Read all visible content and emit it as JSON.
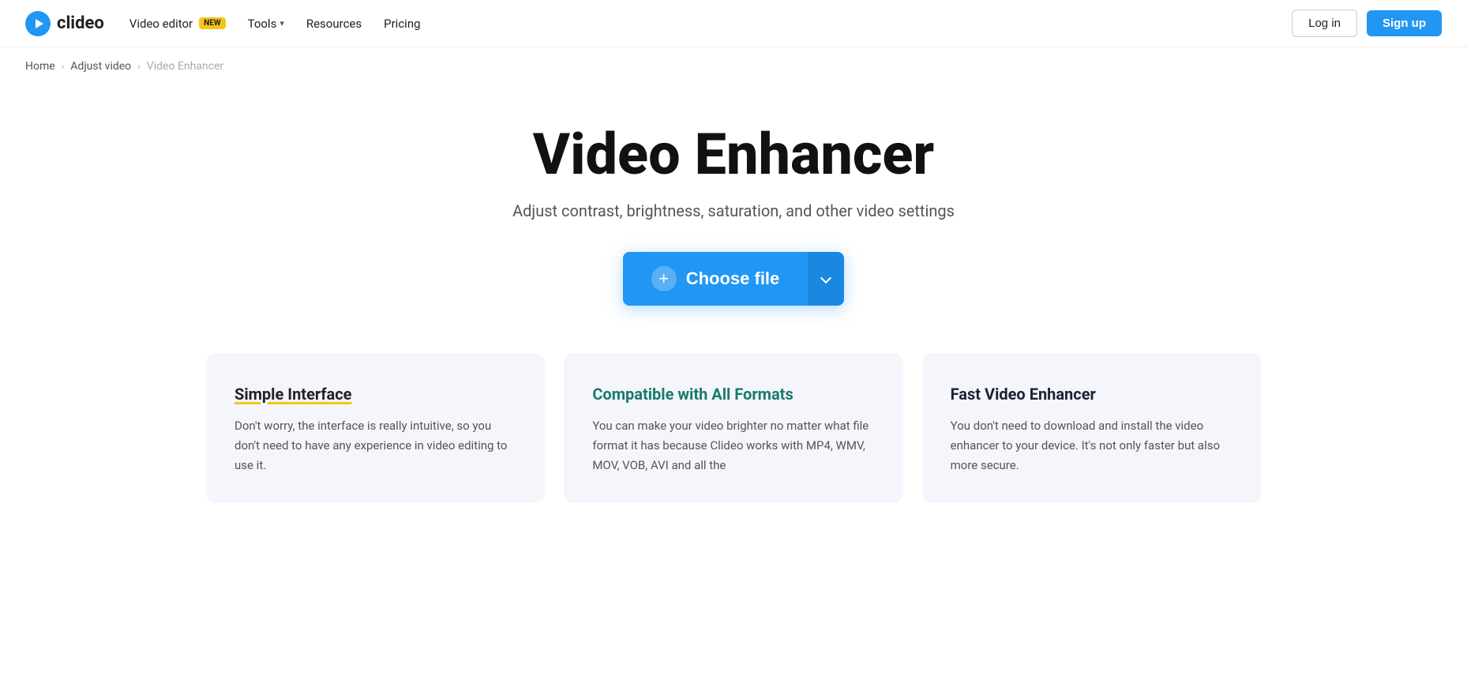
{
  "brand": {
    "name": "clideo",
    "logo_alt": "Clideo logo"
  },
  "navbar": {
    "video_editor_label": "Video editor",
    "video_editor_badge": "NEW",
    "tools_label": "Tools",
    "resources_label": "Resources",
    "pricing_label": "Pricing",
    "login_label": "Log in",
    "signup_label": "Sign up"
  },
  "breadcrumb": {
    "home": "Home",
    "adjust_video": "Adjust video",
    "current": "Video Enhancer"
  },
  "hero": {
    "title": "Video Enhancer",
    "subtitle": "Adjust contrast, brightness, saturation, and other video settings",
    "choose_file_label": "Choose file"
  },
  "features": [
    {
      "id": "simple-interface",
      "title": "Simple Interface",
      "title_style": "yellow-underline",
      "body": "Don't worry, the interface is really intuitive, so you don't need to have any experience in video editing to use it."
    },
    {
      "id": "compatible-formats",
      "title": "Compatible with All Formats",
      "title_style": "teal",
      "body": "You can make your video brighter no matter what file format it has because Clideo works with MP4, WMV, MOV, VOB, AVI and all the"
    },
    {
      "id": "fast-enhancer",
      "title": "Fast Video Enhancer",
      "title_style": "dark",
      "body": "You don't need to download and install the video enhancer to your device. It's not only faster but also more secure."
    }
  ],
  "colors": {
    "primary": "#2196F3",
    "badge_bg": "#f5c518",
    "signup_bg": "#2196F3"
  }
}
